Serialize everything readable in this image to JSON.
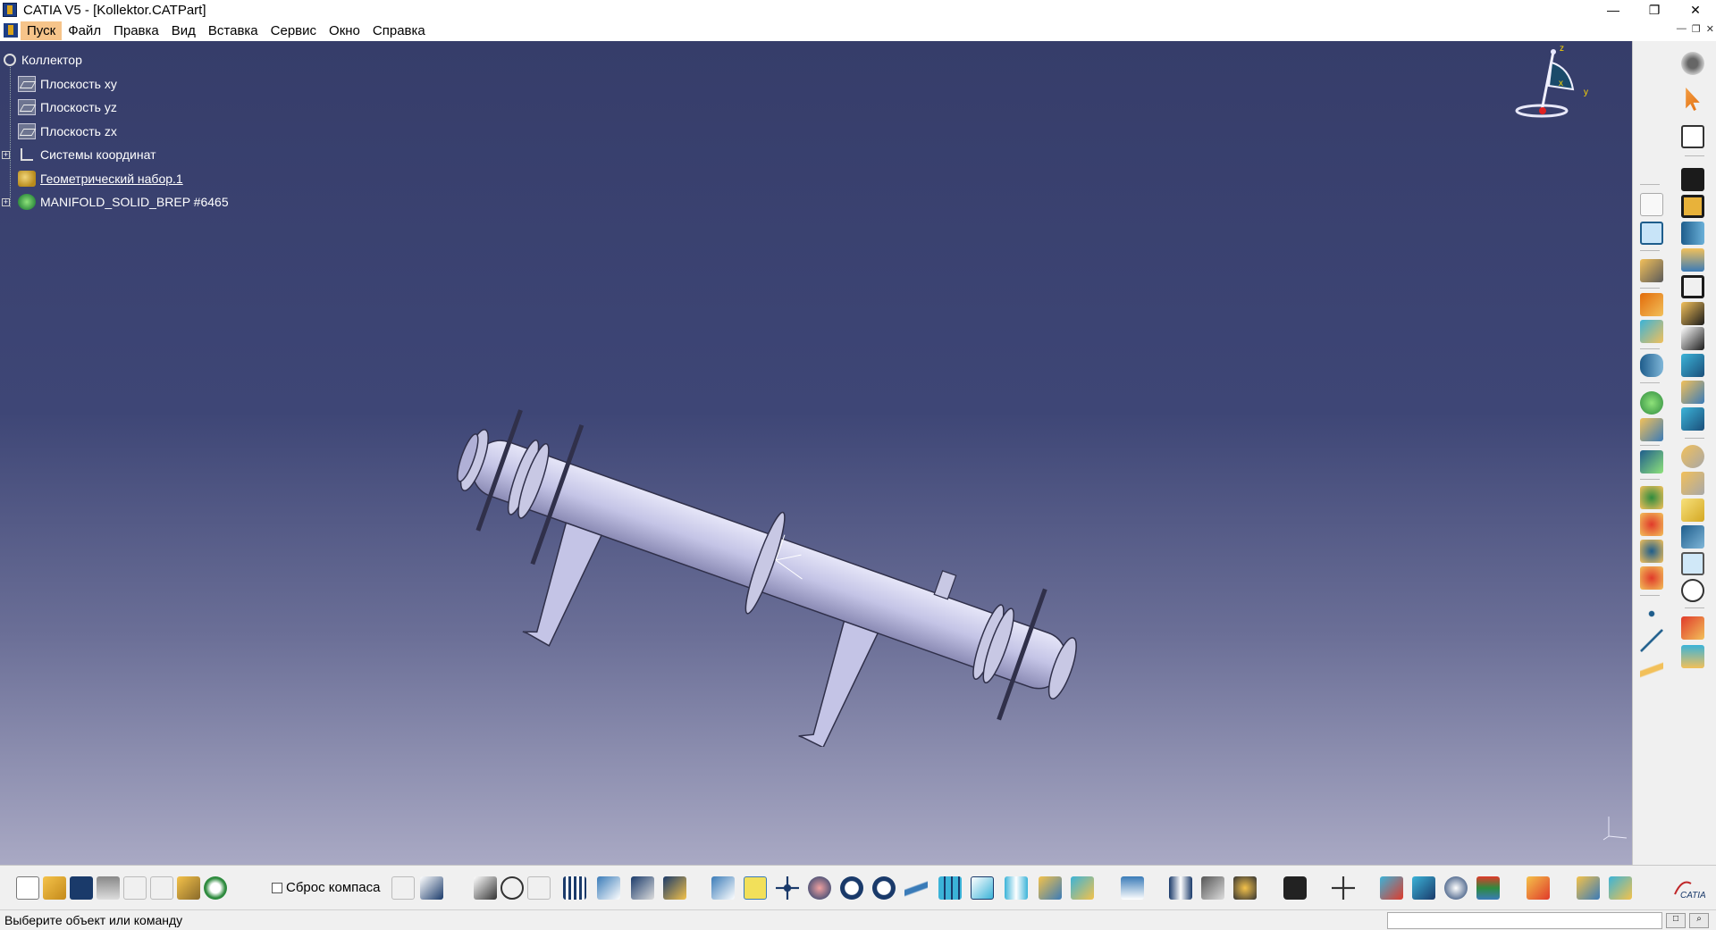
{
  "window": {
    "title": "CATIA V5 - [Kollektor.CATPart]",
    "controls": [
      "minimize",
      "restore",
      "close"
    ]
  },
  "menubar": {
    "items": [
      {
        "label": "Пуск",
        "active": true
      },
      {
        "label": "Файл"
      },
      {
        "label": "Правка"
      },
      {
        "label": "Вид"
      },
      {
        "label": "Вставка"
      },
      {
        "label": "Сервис"
      },
      {
        "label": "Окно"
      },
      {
        "label": "Справка"
      }
    ]
  },
  "tree": {
    "root": "Коллектор",
    "items": [
      {
        "label": "Плоскость xy",
        "icon": "plane-icon"
      },
      {
        "label": "Плоскость yz",
        "icon": "plane-icon"
      },
      {
        "label": "Плоскость zx",
        "icon": "plane-icon"
      },
      {
        "label": "Системы координат",
        "icon": "axis-system-icon",
        "expandable": true
      },
      {
        "label": "Геометрический набор.1",
        "icon": "geometrical-set-icon",
        "underlined": true
      },
      {
        "label": "MANIFOLD_SOLID_BREP #6465",
        "icon": "part-body-icon",
        "expandable": true
      }
    ]
  },
  "compass": {
    "labels": [
      "z",
      "x",
      "y"
    ]
  },
  "toolbar_bottom": {
    "compass_reset_label": "Сброс компаса",
    "compass_reset_checked": false
  },
  "statusbar": {
    "message": "Выберите объект или команду",
    "command_input": ""
  },
  "colors": {
    "viewport_top": "#363d6a",
    "viewport_bottom": "#a9a9c4",
    "model": "#c4c4e6",
    "menu_active": "#f6c48a"
  }
}
